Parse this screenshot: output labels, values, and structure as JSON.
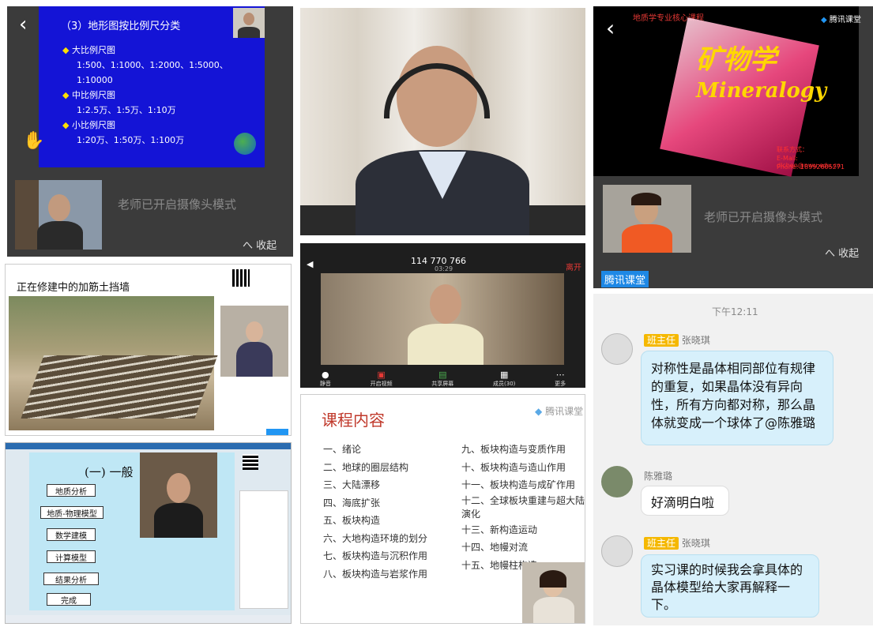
{
  "tile1": {
    "slide_title": "（3）地形图按比例尺分类",
    "items": [
      {
        "heading": "大比例尺图",
        "values": "1:500、1:1000、1:2000、1:5000、1:10000"
      },
      {
        "heading": "中比例尺图",
        "values": "1:2.5万、1:5万、1:10万"
      },
      {
        "heading": "小比例尺图",
        "values": "1:20万、1:50万、1:100万"
      }
    ],
    "camera_notice": "老师已开启摄像头模式",
    "collapse_label": "へ 收起"
  },
  "tile3": {
    "header_text": "地质学专业核心课程",
    "brand": "腾讯课堂",
    "title_cn": "矿物学",
    "title_en": "Mineralogy",
    "camera_notice": "老师已开启摄像头模式",
    "collapse_label": "へ 收起",
    "brand_badge": "腾讯课堂",
    "contact_label": "联系方式：",
    "contact_email": "E-Mail: dlchen@nwu.edu.cn",
    "contact_phone": "Phone: 18992605271"
  },
  "tile4": {
    "slide_title": "正在修建中的加筋土挡墙"
  },
  "tile5": {
    "meeting_id": "114 770 766",
    "timer": "03:29",
    "leave_label": "离开",
    "toolbar": [
      "静音",
      "开启视频",
      "共享屏幕",
      "成员(30)",
      "更多"
    ]
  },
  "tile6": {
    "slide_title": "(一) 一般",
    "flow_steps": [
      "地质分析",
      "地质-物理模型",
      "数学建模",
      "计算模型",
      "结果分析",
      "完成"
    ]
  },
  "tile7": {
    "title": "课程内容",
    "brand": "腾讯课堂",
    "left_items": [
      "一、绪论",
      "二、地球的圈层结构",
      "三、大陆漂移",
      "四、海底扩张",
      "五、板块构造",
      "六、大地构造环境的划分",
      "七、板块构造与沉积作用",
      "八、板块构造与岩浆作用"
    ],
    "right_items": [
      "九、板块构造与变质作用",
      "十、板块构造与造山作用",
      "十一、板块构造与成矿作用",
      "十二、全球板块重建与超大陆演化",
      "十三、新构造运动",
      "十四、地幔对流",
      "十五、地幔柱构造"
    ]
  },
  "chat": {
    "time": "下午12:11",
    "messages": [
      {
        "tag": "班主任",
        "name": "张晓琪",
        "text": "对称性是晶体相同部位有规律的重复，如果晶体没有异向性，所有方向都对称，那么晶体就变成一个球体了@陈雅璐"
      },
      {
        "tag": "",
        "name": "陈雅璐",
        "text": "好滴明白啦"
      },
      {
        "tag": "班主任",
        "name": "张晓琪",
        "text": "实习课的时候我会拿具体的晶体模型给大家再解释一下。"
      }
    ]
  }
}
